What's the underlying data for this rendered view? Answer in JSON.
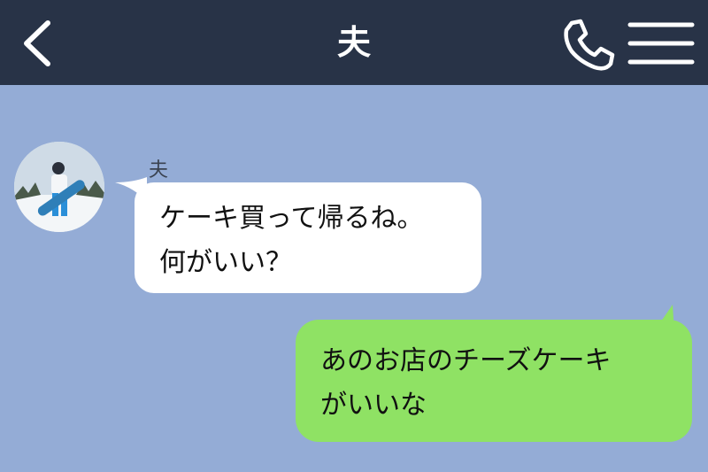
{
  "header": {
    "back_icon": "chevron-left-icon",
    "title": "夫",
    "call_icon": "phone-icon",
    "menu_icon": "hamburger-menu-icon"
  },
  "messages": [
    {
      "direction": "incoming",
      "sender": "夫",
      "lines": [
        "ケーキ買って帰るね。",
        "何がいい？"
      ]
    },
    {
      "direction": "outgoing",
      "lines": [
        "あのお店のチーズケーキ",
        "がいいな"
      ]
    }
  ],
  "colors": {
    "header_bg": "#283347",
    "chat_bg": "#94acd6",
    "incoming_bubble": "#ffffff",
    "outgoing_bubble": "#8fe264"
  }
}
